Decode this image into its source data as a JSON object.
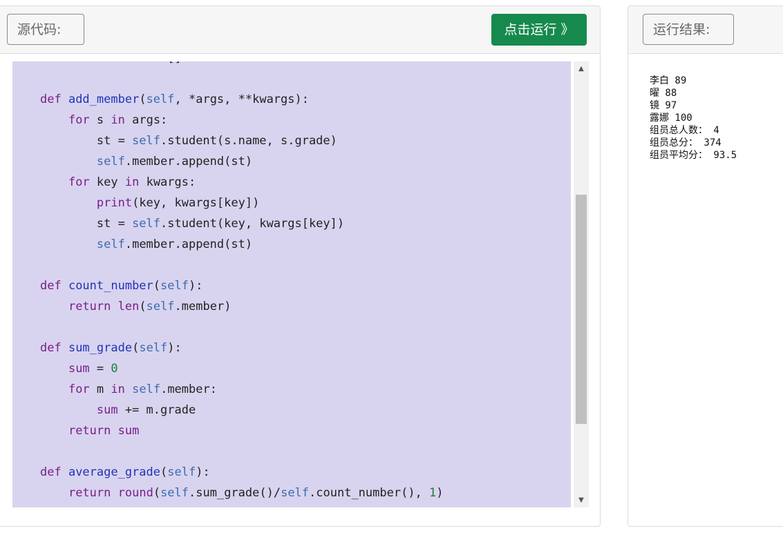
{
  "source_panel": {
    "label": "源代码:",
    "run_button": "点击运行 》",
    "code_lines": [
      [
        {
          "t": "    ",
          "c": ""
        },
        {
          "t": "self",
          "c": "sf"
        },
        {
          "t": ".member = []",
          "c": ""
        }
      ],
      [],
      [
        {
          "t": "def ",
          "c": "kw"
        },
        {
          "t": "add_member",
          "c": "fn"
        },
        {
          "t": "(",
          "c": ""
        },
        {
          "t": "self",
          "c": "sf"
        },
        {
          "t": ", *args, **kwargs):",
          "c": ""
        }
      ],
      [
        {
          "t": "    ",
          "c": ""
        },
        {
          "t": "for",
          "c": "kw"
        },
        {
          "t": " s ",
          "c": ""
        },
        {
          "t": "in",
          "c": "kw"
        },
        {
          "t": " args:",
          "c": ""
        }
      ],
      [
        {
          "t": "        st = ",
          "c": ""
        },
        {
          "t": "self",
          "c": "sf"
        },
        {
          "t": ".student(s.name, s.grade)",
          "c": ""
        }
      ],
      [
        {
          "t": "        ",
          "c": ""
        },
        {
          "t": "self",
          "c": "sf"
        },
        {
          "t": ".member.append(st)",
          "c": ""
        }
      ],
      [
        {
          "t": "    ",
          "c": ""
        },
        {
          "t": "for",
          "c": "kw"
        },
        {
          "t": " key ",
          "c": ""
        },
        {
          "t": "in",
          "c": "kw"
        },
        {
          "t": " kwargs:",
          "c": ""
        }
      ],
      [
        {
          "t": "        ",
          "c": ""
        },
        {
          "t": "print",
          "c": "bi"
        },
        {
          "t": "(key, kwargs[key])",
          "c": ""
        }
      ],
      [
        {
          "t": "        st = ",
          "c": ""
        },
        {
          "t": "self",
          "c": "sf"
        },
        {
          "t": ".student(key, kwargs[key])",
          "c": ""
        }
      ],
      [
        {
          "t": "        ",
          "c": ""
        },
        {
          "t": "self",
          "c": "sf"
        },
        {
          "t": ".member.append(st)",
          "c": ""
        }
      ],
      [],
      [
        {
          "t": "def ",
          "c": "kw"
        },
        {
          "t": "count_number",
          "c": "fn"
        },
        {
          "t": "(",
          "c": ""
        },
        {
          "t": "self",
          "c": "sf"
        },
        {
          "t": "):",
          "c": ""
        }
      ],
      [
        {
          "t": "    ",
          "c": ""
        },
        {
          "t": "return",
          "c": "kw"
        },
        {
          "t": " ",
          "c": ""
        },
        {
          "t": "len",
          "c": "bi"
        },
        {
          "t": "(",
          "c": ""
        },
        {
          "t": "self",
          "c": "sf"
        },
        {
          "t": ".member)",
          "c": ""
        }
      ],
      [],
      [
        {
          "t": "def ",
          "c": "kw"
        },
        {
          "t": "sum_grade",
          "c": "fn"
        },
        {
          "t": "(",
          "c": ""
        },
        {
          "t": "self",
          "c": "sf"
        },
        {
          "t": "):",
          "c": ""
        }
      ],
      [
        {
          "t": "    ",
          "c": ""
        },
        {
          "t": "sum",
          "c": "bi"
        },
        {
          "t": " = ",
          "c": ""
        },
        {
          "t": "0",
          "c": "num"
        }
      ],
      [
        {
          "t": "    ",
          "c": ""
        },
        {
          "t": "for",
          "c": "kw"
        },
        {
          "t": " m ",
          "c": ""
        },
        {
          "t": "in",
          "c": "kw"
        },
        {
          "t": " ",
          "c": ""
        },
        {
          "t": "self",
          "c": "sf"
        },
        {
          "t": ".member:",
          "c": ""
        }
      ],
      [
        {
          "t": "        ",
          "c": ""
        },
        {
          "t": "sum",
          "c": "bi"
        },
        {
          "t": " += m.grade",
          "c": ""
        }
      ],
      [
        {
          "t": "    ",
          "c": ""
        },
        {
          "t": "return",
          "c": "kw"
        },
        {
          "t": " ",
          "c": ""
        },
        {
          "t": "sum",
          "c": "bi"
        }
      ],
      [],
      [
        {
          "t": "def ",
          "c": "kw"
        },
        {
          "t": "average_grade",
          "c": "fn"
        },
        {
          "t": "(",
          "c": ""
        },
        {
          "t": "self",
          "c": "sf"
        },
        {
          "t": "):",
          "c": ""
        }
      ],
      [
        {
          "t": "    ",
          "c": ""
        },
        {
          "t": "return",
          "c": "kw"
        },
        {
          "t": " ",
          "c": ""
        },
        {
          "t": "round",
          "c": "bi"
        },
        {
          "t": "(",
          "c": ""
        },
        {
          "t": "self",
          "c": "sf"
        },
        {
          "t": ".sum_grade()/",
          "c": ""
        },
        {
          "t": "self",
          "c": "sf"
        },
        {
          "t": ".count_number(), ",
          "c": ""
        },
        {
          "t": "1",
          "c": "num"
        },
        {
          "t": ")",
          "c": ""
        }
      ]
    ],
    "scrollbar": {
      "position": 0.63
    }
  },
  "output_panel": {
    "label": "运行结果:",
    "output_text": "李白 89\n曜 88\n镜 97\n露娜 100\n组员总人数： 4\n组员总分： 374\n组员平均分： 93.5"
  },
  "colors": {
    "run_button": "#168a4d",
    "editor_bg": "#d8d4ef",
    "keyword": "#7a1e86",
    "function": "#2232b8",
    "self": "#3d6bb0",
    "number": "#1f7a3a"
  }
}
